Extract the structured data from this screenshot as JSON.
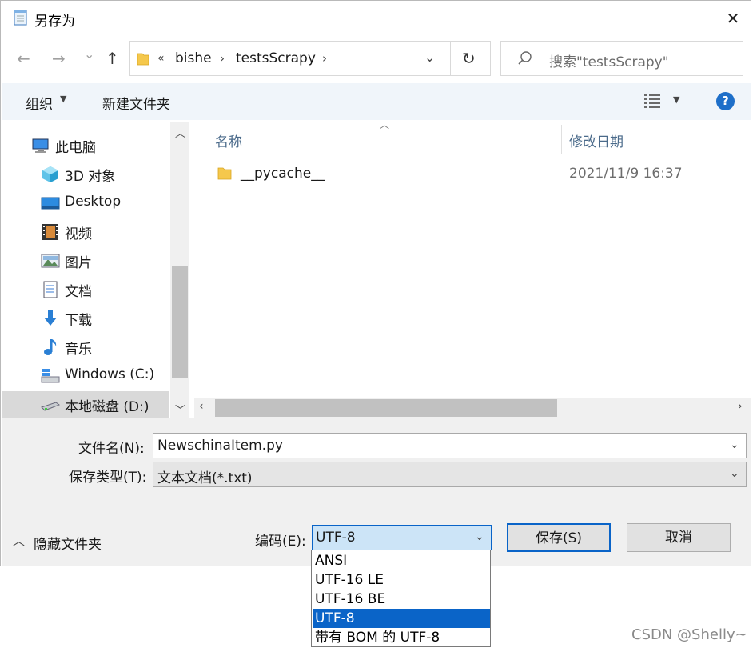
{
  "window": {
    "title": "另存为",
    "close_label": "✕"
  },
  "nav": {
    "back": "←",
    "forward": "→",
    "recent": "⌄",
    "up": "↑",
    "breadcrumb": [
      "«",
      "bishe",
      "testsScrapy"
    ],
    "refresh": "↻",
    "search_placeholder": "搜索\"testsScrapy\""
  },
  "toolbar": {
    "organize": "组织",
    "new_folder": "新建文件夹",
    "help": "?"
  },
  "sidebar": {
    "items": [
      {
        "label": "此电脑",
        "icon": "computer-icon"
      },
      {
        "label": "3D 对象",
        "icon": "cube-icon"
      },
      {
        "label": "Desktop",
        "icon": "desktop-icon"
      },
      {
        "label": "视频",
        "icon": "video-icon"
      },
      {
        "label": "图片",
        "icon": "picture-icon"
      },
      {
        "label": "文档",
        "icon": "document-icon"
      },
      {
        "label": "下载",
        "icon": "download-icon"
      },
      {
        "label": "音乐",
        "icon": "music-icon"
      },
      {
        "label": "Windows (C:)",
        "icon": "drive-c-icon"
      },
      {
        "label": "本地磁盘 (D:)",
        "icon": "drive-d-icon"
      }
    ]
  },
  "file_list": {
    "columns": [
      "名称",
      "修改日期"
    ],
    "rows": [
      {
        "name": "__pycache__",
        "modified": "2021/11/9 16:37"
      }
    ]
  },
  "form": {
    "filename_label": "文件名(N):",
    "filename_value": "NewschinaItem.py",
    "filetype_label": "保存类型(T):",
    "filetype_value": "文本文档(*.txt)",
    "hide_folders": "隐藏文件夹",
    "encoding_label": "编码(E):",
    "encoding_value": "UTF-8",
    "save": "保存(S)",
    "cancel": "取消"
  },
  "encoding_options": [
    "ANSI",
    "UTF-16 LE",
    "UTF-16 BE",
    "UTF-8",
    "带有 BOM 的 UTF-8"
  ],
  "watermark": "CSDN @Shelly~",
  "colors": {
    "accent": "#0a64c8",
    "selection": "#cce4f7",
    "help": "#1e6fc9"
  }
}
